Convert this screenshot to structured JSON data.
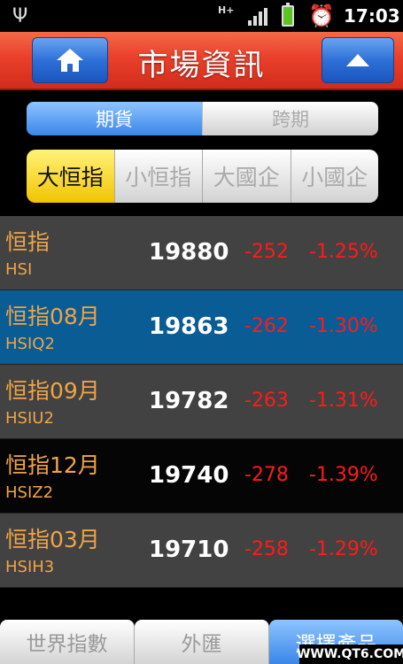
{
  "status_bar": {
    "time": "17:03",
    "network": "H+",
    "icons": [
      "usb-icon",
      "signal-icon",
      "battery-icon",
      "alarm-icon"
    ]
  },
  "header": {
    "title": "市場資訊",
    "home_icon": "home-icon",
    "up_icon": "up-arrow-icon"
  },
  "mode_tabs": [
    {
      "label": "期貨",
      "selected": true
    },
    {
      "label": "跨期",
      "selected": false
    }
  ],
  "category_tabs": [
    {
      "label": "大恒指",
      "selected": true
    },
    {
      "label": "小恒指",
      "selected": false
    },
    {
      "label": "大國企",
      "selected": false
    },
    {
      "label": "小國企",
      "selected": false
    }
  ],
  "quotes": [
    {
      "name": "恒指",
      "code": "HSI",
      "price": "19880",
      "change": "-252",
      "change_pct": "-1.25%"
    },
    {
      "name": "恒指08月",
      "code": "HSIQ2",
      "price": "19863",
      "change": "-262",
      "change_pct": "-1.30%"
    },
    {
      "name": "恒指09月",
      "code": "HSIU2",
      "price": "19782",
      "change": "-263",
      "change_pct": "-1.31%"
    },
    {
      "name": "恒指12月",
      "code": "HSIZ2",
      "price": "19740",
      "change": "-278",
      "change_pct": "-1.39%"
    },
    {
      "name": "恒指03月",
      "code": "HSIH3",
      "price": "19710",
      "change": "-258",
      "change_pct": "-1.29%"
    }
  ],
  "bottom_tabs": [
    {
      "label": "世界指數",
      "selected": false
    },
    {
      "label": "外匯",
      "selected": false
    },
    {
      "label": "選擇產品",
      "selected": true
    }
  ],
  "watermark": "WWW.QT6.COM",
  "colors": {
    "header_red": "#e9402a",
    "accent_blue": "#2e70d8",
    "price_down": "#ff1a1a",
    "name_orange": "#f0a447",
    "selected_yellow": "#f2c400",
    "row_highlight": "#0a5c94"
  }
}
